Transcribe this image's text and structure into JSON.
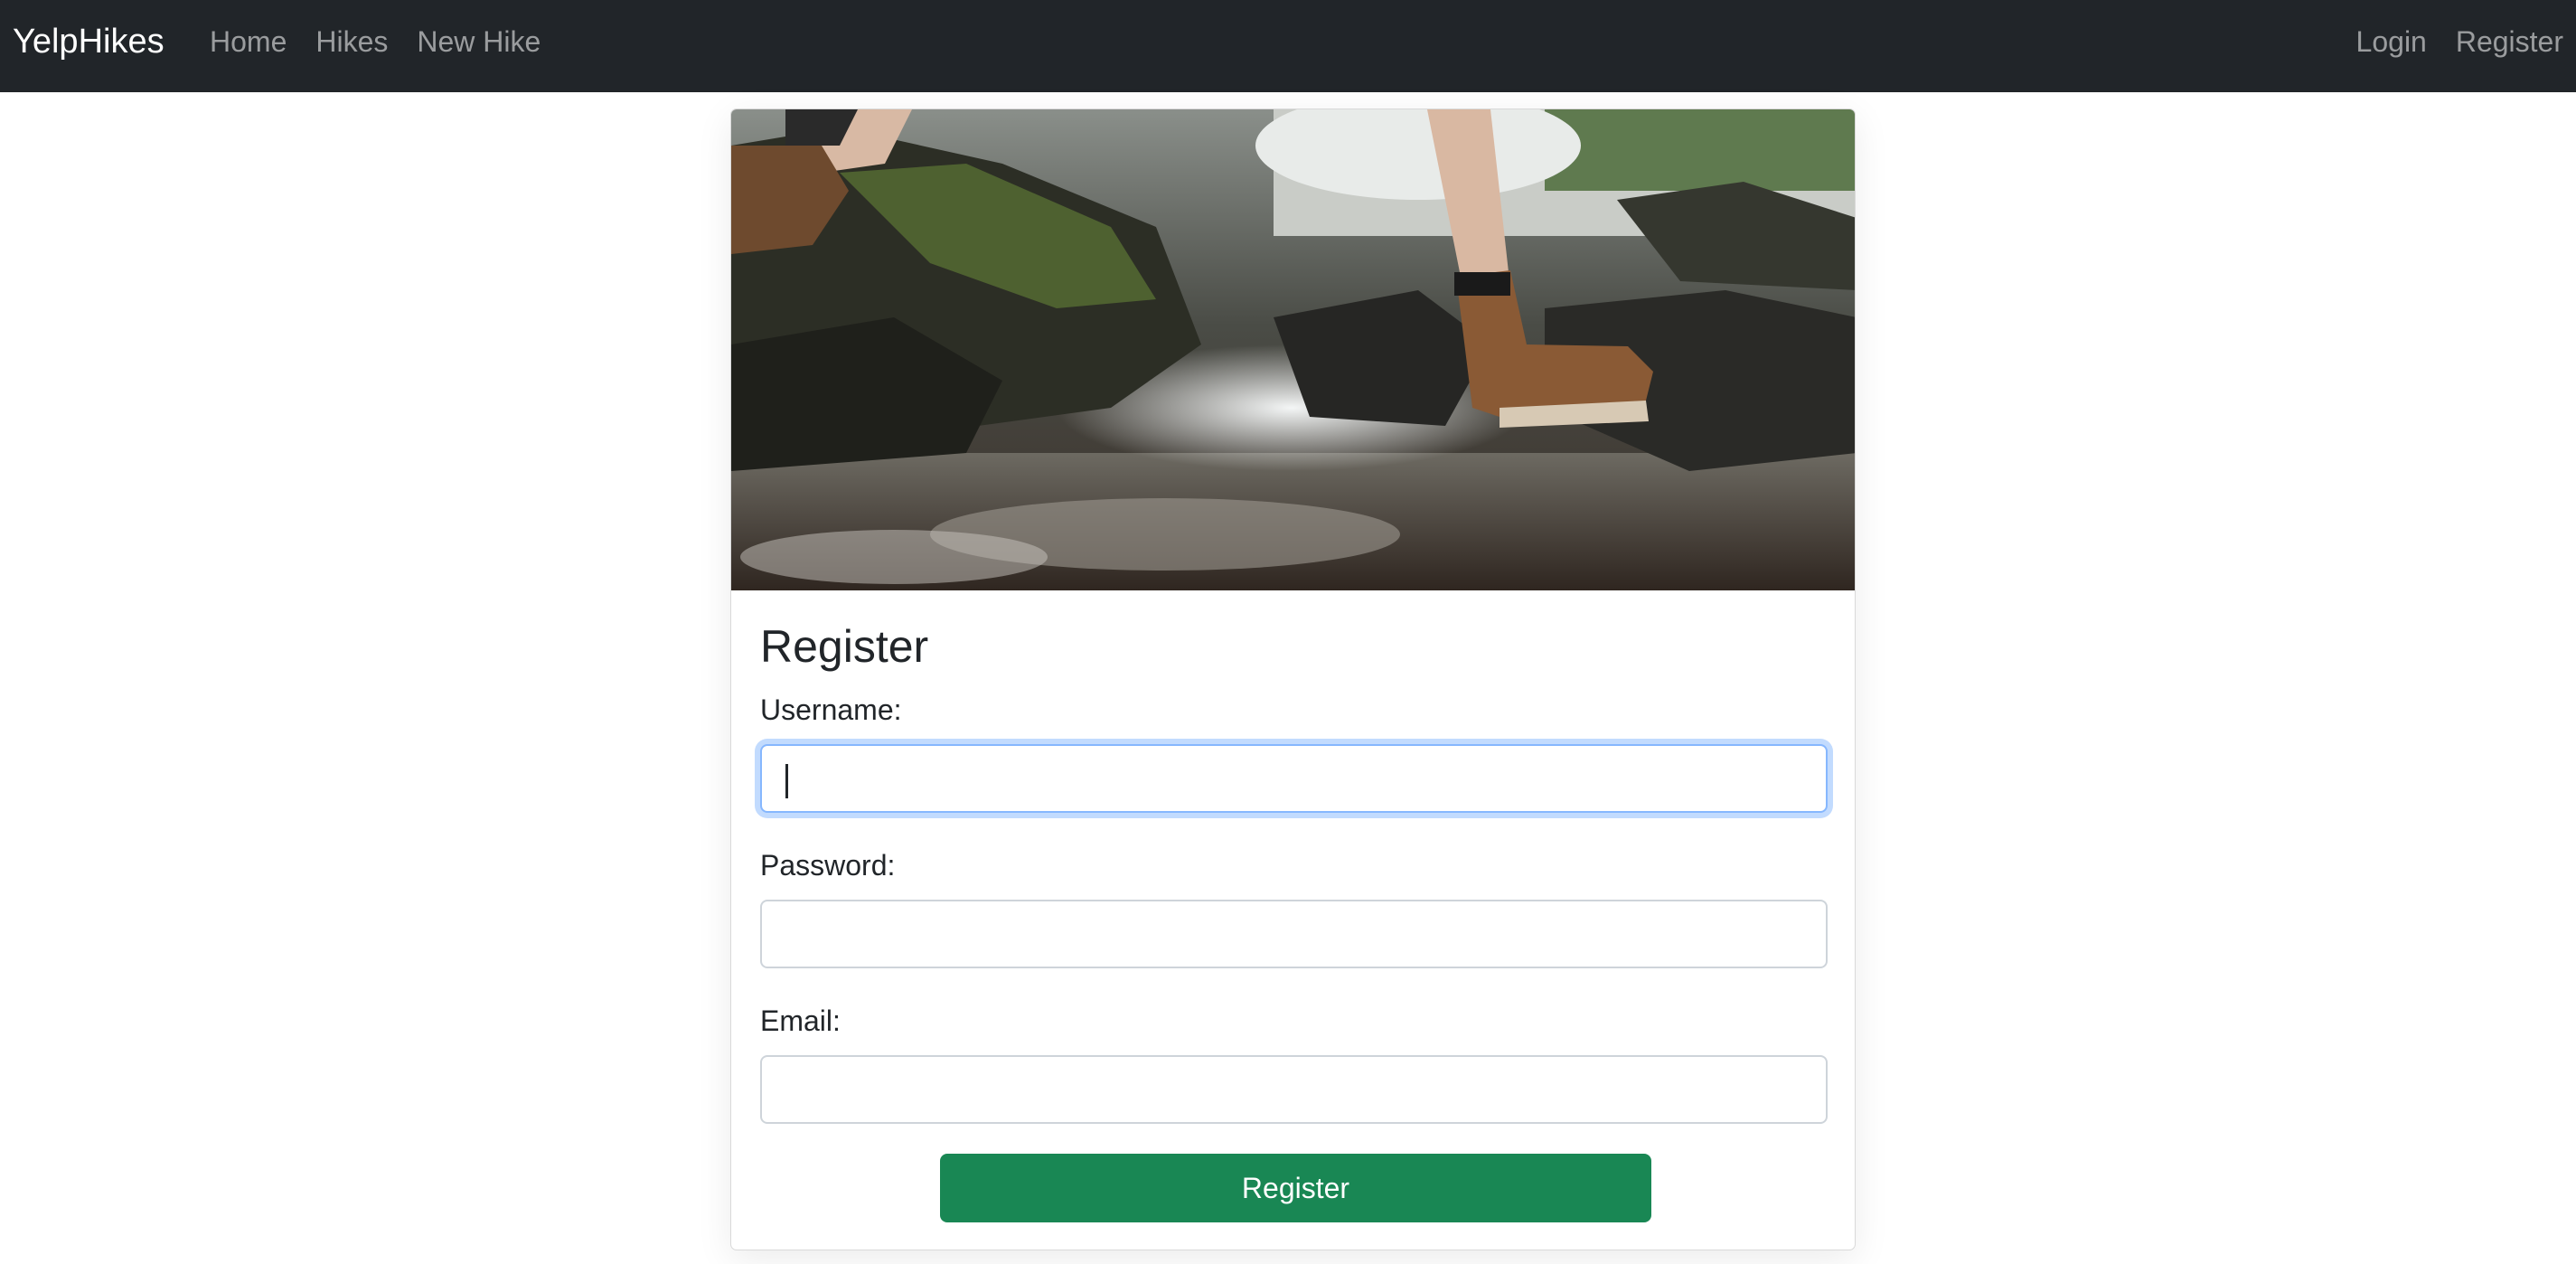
{
  "navbar": {
    "brand": "YelpHikes",
    "left_links": [
      "Home",
      "Hikes",
      "New Hike"
    ],
    "right_links": [
      "Login",
      "Register"
    ],
    "background": "#212529"
  },
  "hero_image": {
    "subject": "hiker stepping over a rocky stream in brown leather boots"
  },
  "form": {
    "title": "Register",
    "username_label": "Username:",
    "username_value": "",
    "password_label": "Password:",
    "password_value": "",
    "email_label": "Email:",
    "email_value": "",
    "submit_label": "Register",
    "submit_color": "#198754",
    "focus_color": "#86b7fe"
  }
}
